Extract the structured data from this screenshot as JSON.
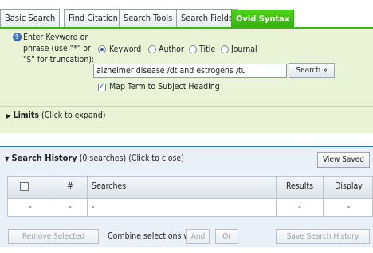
{
  "tabs": [
    {
      "label": "Basic Search",
      "active": false
    },
    {
      "label": "Find Citation",
      "active": false
    },
    {
      "label": "Search Tools",
      "active": false
    },
    {
      "label": "Search Fields",
      "active": false
    },
    {
      "label": "Ovid Syntax",
      "active": true
    }
  ],
  "search": {
    "prompt": "Enter Keyword or phrase (use \"*\" or \"$\" for truncation):",
    "modes": [
      {
        "label": "Keyword",
        "selected": true
      },
      {
        "label": "Author",
        "selected": false
      },
      {
        "label": "Title",
        "selected": false
      },
      {
        "label": "Journal",
        "selected": false
      }
    ],
    "query": "alzheimer disease /dt and estrogens /tu",
    "button_label": "Search »",
    "map_term_label": "Map Term to Subject Heading",
    "map_term_checked": true
  },
  "limits": {
    "title": "Limits",
    "hint": "(Click to expand)"
  },
  "history": {
    "title": "Search History",
    "count_text": "(0 searches)",
    "toggle_hint": "(Click to close)",
    "view_saved_label": "View Saved",
    "columns": {
      "number": "#",
      "searches": "Searches",
      "results": "Results",
      "display": "Display"
    },
    "empty_row": {
      "select": "-",
      "number": "-",
      "searches": "-",
      "results": "-",
      "display": "-"
    },
    "remove_selected_label": "Remove Selected",
    "combine_label": "Combine selections with:",
    "and_label": "And",
    "or_label": "Or",
    "save_history_label": "Save Search History"
  },
  "colors": {
    "tab_active": "#3cb814",
    "search_panel_bg": "#eaf3d6",
    "history_accent": "#2e74c8"
  }
}
